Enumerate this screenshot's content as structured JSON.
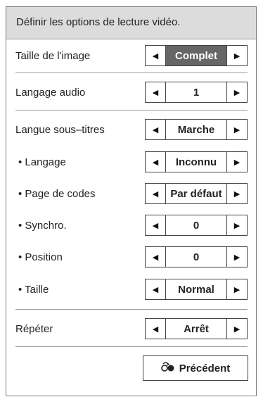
{
  "header": {
    "title": "Définir les options de lecture vidéo."
  },
  "rows": [
    {
      "label": "Taille de l'image",
      "value": "Complet",
      "active": true
    },
    {
      "label": "Langage audio",
      "value": "1"
    },
    {
      "label": "Langue sous–titres",
      "value": "Marche"
    },
    {
      "label": "• Langage",
      "value": "Inconnu"
    },
    {
      "label": "• Page de codes",
      "value": "Par défaut"
    },
    {
      "label": "• Synchro.",
      "value": "0"
    },
    {
      "label": "• Position",
      "value": "0"
    },
    {
      "label": "• Taille",
      "value": "Normal"
    },
    {
      "label": "Répéter",
      "value": "Arrêt"
    }
  ],
  "footer": {
    "back_label": "Précédent"
  },
  "icons": {
    "left": "left-arrow-icon",
    "right": "right-arrow-icon",
    "back": "back-icon"
  }
}
